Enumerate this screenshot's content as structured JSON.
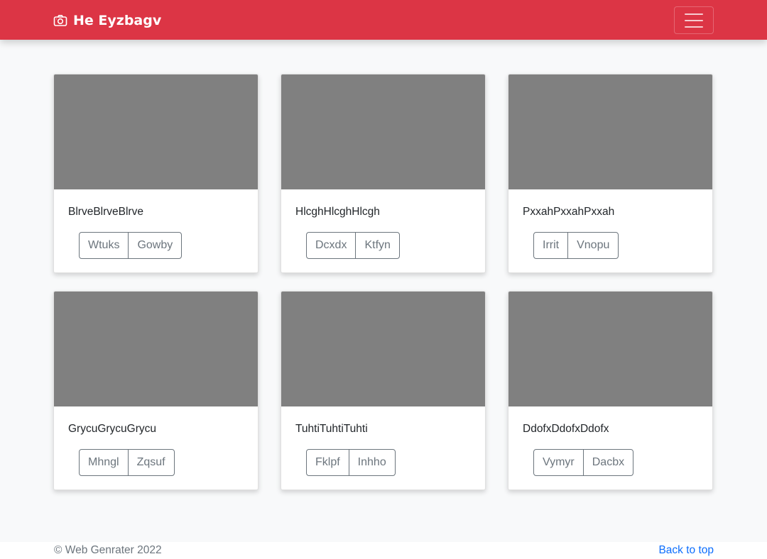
{
  "navbar": {
    "brand_icon": "camera-icon",
    "brand_text": "He Eyzbagv",
    "toggler_icon": "hamburger-menu-icon",
    "color": "#dc3545"
  },
  "cards": [
    {
      "title": "BlrveBlrveBlrve",
      "buttons": [
        "Wtuks",
        "Gowby"
      ]
    },
    {
      "title": "HlcghHlcghHlcgh",
      "buttons": [
        "Dcxdx",
        "Ktfyn"
      ]
    },
    {
      "title": "PxxahPxxahPxxah",
      "buttons": [
        "Irrit",
        "Vnopu"
      ]
    },
    {
      "title": "GrycuGrycuGrycu",
      "buttons": [
        "Mhngl",
        "Zqsuf"
      ]
    },
    {
      "title": "TuhtiTuhtiTuhti",
      "buttons": [
        "Fklpf",
        "Inhho"
      ]
    },
    {
      "title": "DdofxDdofxDdofx",
      "buttons": [
        "Vymyr",
        "Dacbx"
      ]
    }
  ],
  "footer": {
    "copyright": "© Web Genrater 2022",
    "back_to_top": "Back to top"
  }
}
